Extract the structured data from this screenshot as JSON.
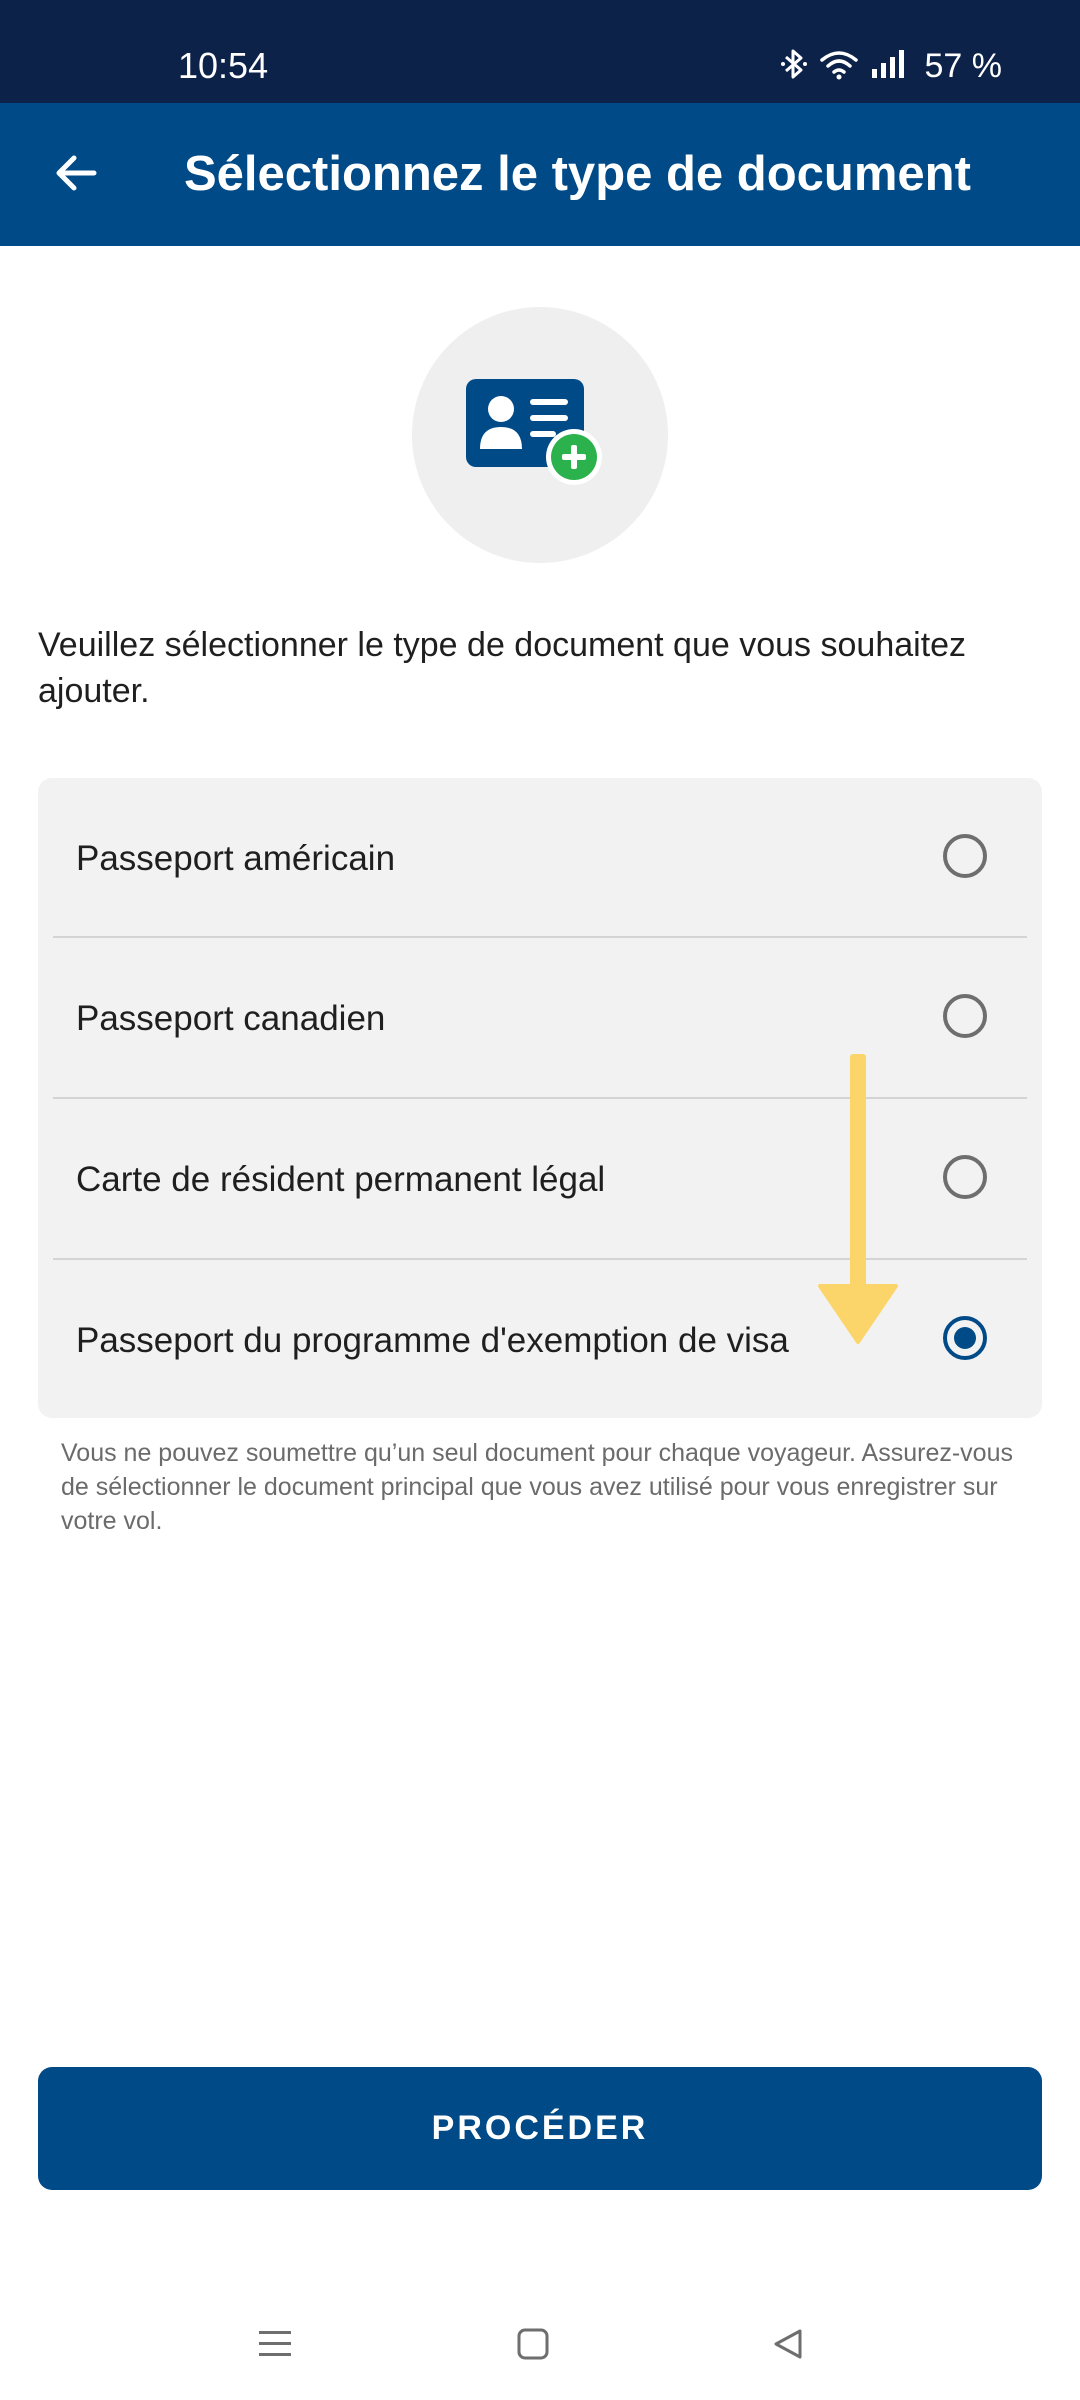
{
  "status_bar": {
    "time": "10:54",
    "battery": "57 %",
    "icons": [
      "bluetooth-icon",
      "wifi-icon",
      "signal-icon"
    ]
  },
  "app_bar": {
    "title": "Sélectionnez le type de document",
    "back_icon": "back-arrow-icon"
  },
  "hero": {
    "icon": "id-card-add-icon"
  },
  "instruction": "Veuillez sélectionner le type de document que vous souhaitez ajouter.",
  "options": [
    {
      "label": "Passeport américain",
      "selected": false
    },
    {
      "label": "Passeport canadien",
      "selected": false
    },
    {
      "label": "Carte de résident permanent légal",
      "selected": false
    },
    {
      "label": "Passeport du programme d'exemption de visa",
      "selected": true
    }
  ],
  "helper_text": "Vous ne pouvez soumettre qu’un seul document pour chaque voyageur. Assurez-vous de sélectionner le document principal que vous avez utilisé pour vous enregistrer sur votre vol.",
  "proceed_button": {
    "label": "PROCÉDER"
  },
  "nav_bar": {
    "icons": [
      "recent-apps-icon",
      "home-icon",
      "back-triangle-icon"
    ]
  },
  "colors": {
    "status_bar": "#0d2249",
    "primary": "#004a87",
    "card_background": "#f2f2f2",
    "accent_green": "#2bb24c",
    "annotation_arrow": "#fcd56a"
  }
}
